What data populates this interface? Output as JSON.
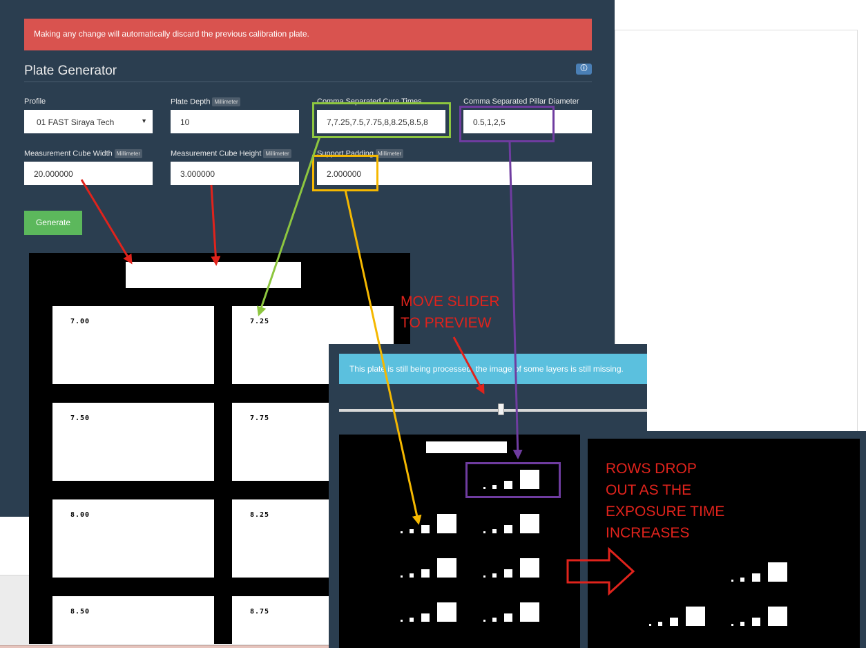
{
  "alert": {
    "text": "Making any change will automatically discard the previous calibration plate."
  },
  "plate_generator": {
    "title": "Plate Generator",
    "info_icon": "info-icon",
    "fields": {
      "profile": {
        "label": "Profile",
        "value": "01 FAST Siraya Tech"
      },
      "plate_depth": {
        "label": "Plate Depth",
        "unit": "Millimeter",
        "value": "10"
      },
      "cure_times": {
        "label": "Comma Separated Cure Times",
        "value": "7,7.25,7.5,7.75,8,8.25,8.5,8"
      },
      "pillar_diameter": {
        "label": "Comma Separated Pillar Diameter",
        "value": "0.5,1,2,5"
      },
      "cube_width": {
        "label": "Measurement Cube Width",
        "unit": "Millimeter",
        "value": "20.000000"
      },
      "cube_height": {
        "label": "Measurement Cube Height",
        "unit": "Millimeter",
        "value": "3.000000"
      },
      "support_padding": {
        "label": "Support Padding",
        "unit": "Millimeter",
        "value": "2.000000"
      }
    },
    "generate_label": "Generate"
  },
  "plate_preview": {
    "cure_labels": [
      "7.00",
      "7.25",
      "7.50",
      "7.75",
      "8.00",
      "8.25",
      "8.50",
      "8.75"
    ]
  },
  "processing": {
    "alert_text": "This plate is still being processed, the image of some layers is still missing.",
    "slider_position": 0.52
  },
  "annotations": {
    "move_slider": [
      "MOVE SLIDER",
      "TO PREVIEW"
    ],
    "rows_drop": [
      "ROWS DROP",
      "OUT AS THE",
      "EXPOSURE TIME",
      "INCREASES"
    ]
  },
  "colors": {
    "panel_bg": "#2b3e50",
    "alert_danger": "#d9534f",
    "alert_info": "#5bc0de",
    "generate_button": "#5cb85c",
    "annotation_red": "#e0231c",
    "highlight_green": "#8dc63f",
    "highlight_purple": "#6f3ca0",
    "highlight_yellow": "#f5b800"
  }
}
